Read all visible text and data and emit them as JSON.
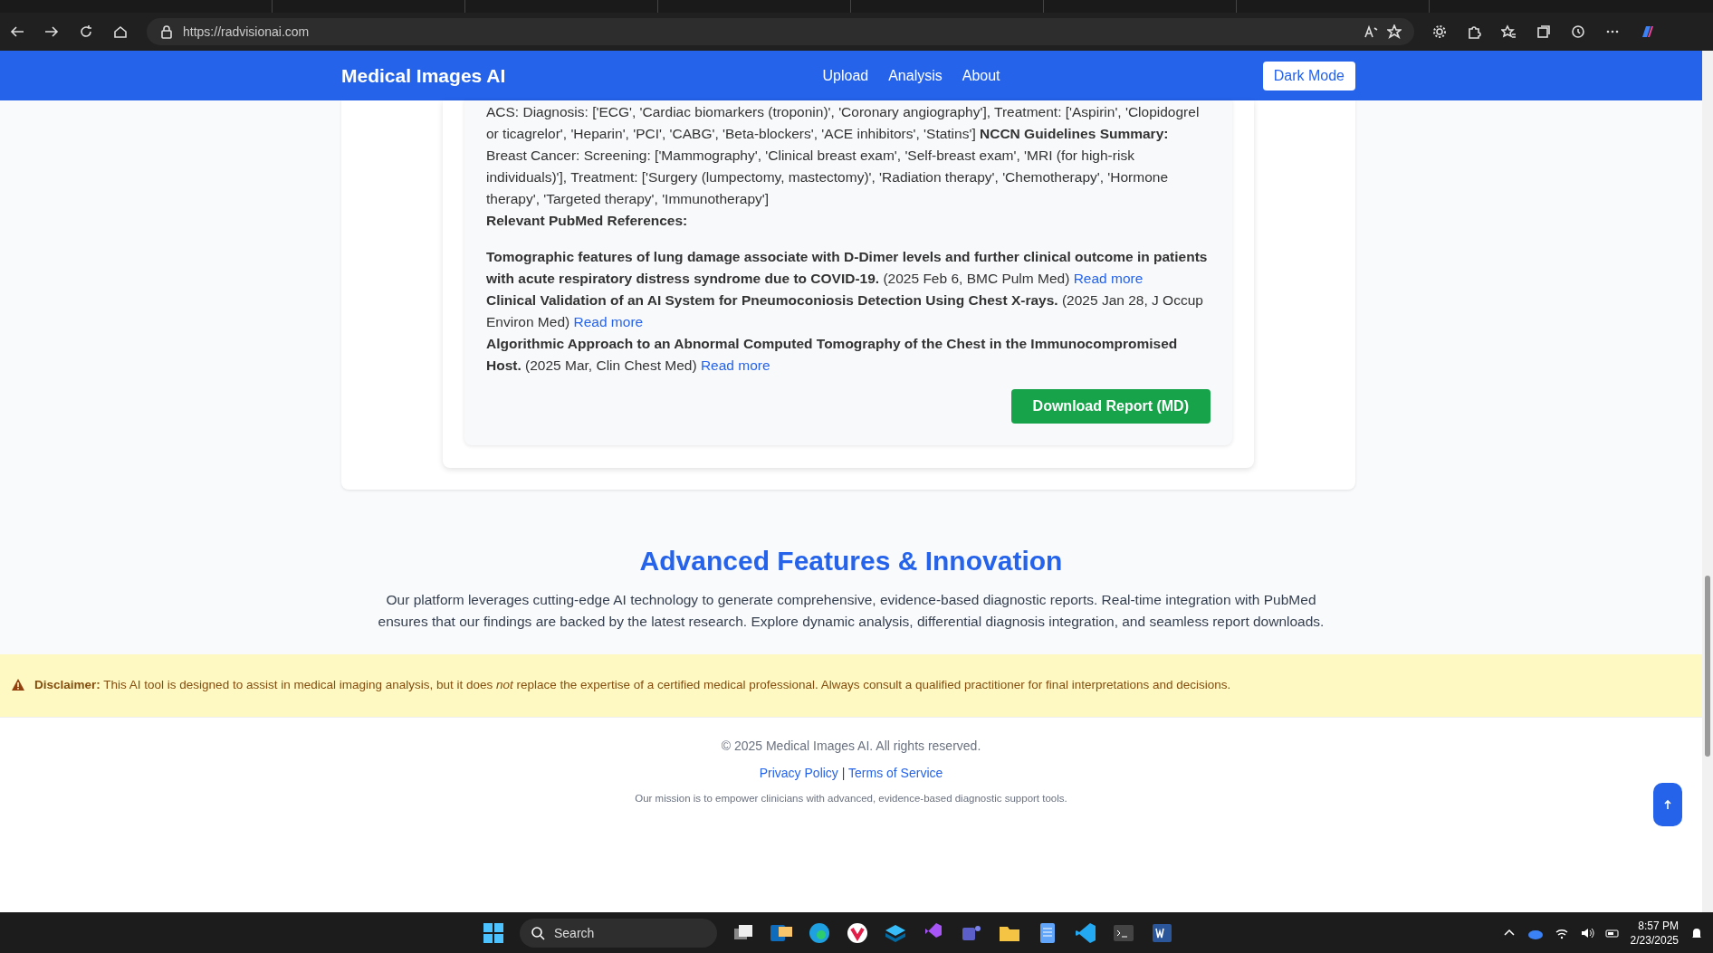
{
  "browser": {
    "url": "https://radvisionai.com"
  },
  "navbar": {
    "brand": "Medical Images AI",
    "links": [
      {
        "label": "Upload"
      },
      {
        "label": "Analysis"
      },
      {
        "label": "About"
      }
    ],
    "theme_button": "Dark Mode"
  },
  "report": {
    "summary": "ACS: Diagnosis: ['ECG', 'Cardiac biomarkers (troponin)', 'Coronary angiography'], Treatment: ['Aspirin', 'Clopidogrel or ticagrelor', 'Heparin', 'PCI', 'CABG', 'Beta-blockers', 'ACE inhibitors', 'Statins'] **NCCN Guidelines Summary:** Breast Cancer: Screening: ['Mammography', 'Clinical breast exam', 'Self-breast exam', 'MRI (for high-risk individuals)'], Treatment: ['Surgery (lumpectomy, mastectomy)', 'Radiation therapy', 'Chemotherapy', 'Hormone therapy', 'Targeted therapy', 'Immunotherapy']",
    "references_heading": "Relevant PubMed References:",
    "references": [
      {
        "title": "Tomographic features of lung damage associate with D-Dimer levels and further clinical outcome in patients with acute respiratory distress syndrome due to COVID-19.",
        "source": "(2025 Feb 6, BMC Pulm Med)",
        "link": "Read more"
      },
      {
        "title": "Clinical Validation of an AI System for Pneumoconiosis Detection Using Chest X-rays.",
        "source": "(2025 Jan 28, J Occup Environ Med)",
        "link": "Read more"
      },
      {
        "title": "Algorithmic Approach to an Abnormal Computed Tomography of the Chest in the Immunocompromised Host.",
        "source": "(2025 Mar, Clin Chest Med)",
        "link": "Read more"
      }
    ],
    "download_button": "Download Report (MD)"
  },
  "features": {
    "heading": "Advanced Features & Innovation",
    "text": "Our platform leverages cutting-edge AI technology to generate comprehensive, evidence-based diagnostic reports. Real-time integration with PubMed ensures that our findings are backed by the latest research. Explore dynamic analysis, differential diagnosis integration, and seamless report downloads."
  },
  "disclaimer": "**Disclaimer:** This AI tool is designed to assist in medical imaging analysis, but it does *not* replace the expertise of a certified medical professional. Always consult a qualified practitioner for final interpretations and decisions.",
  "footer": {
    "copyright": "© 2025 Medical Images AI. All rights reserved.",
    "links": [
      "Privacy Policy",
      "Terms of Service"
    ],
    "separator": "|",
    "mission": "Our mission is to empower clinicians with advanced, evidence-based diagnostic support tools."
  },
  "taskbar": {
    "search_placeholder": "Search",
    "time": "8:57 PM",
    "date": "2/23/2025"
  }
}
